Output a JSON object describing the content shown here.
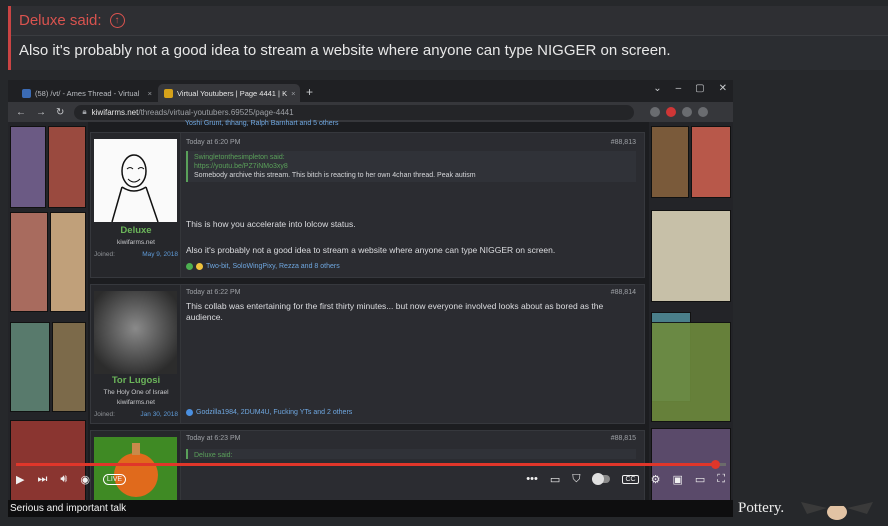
{
  "quote": {
    "author": "Deluxe said:",
    "text": "Also it's probably not a good idea to stream a website where anyone can type NIGGER on screen."
  },
  "browser": {
    "tabs": [
      {
        "label": "(58) /vt/ - Ames Thread - Virtual",
        "active": false
      },
      {
        "label": "Virtual Youtubers | Page 4441 | K",
        "active": true
      }
    ],
    "url_host": "kiwifarms.net",
    "url_path": "/threads/virtual-youtubers.69525/page-4441"
  },
  "forum": {
    "top_reactions": "Yoshi Grunt, thhang, Ralph Barnhart and 5 others",
    "posts": [
      {
        "user": "Deluxe",
        "user_title": "kiwifarms.net",
        "joined_label": "Joined:",
        "joined_date": "May 9, 2018",
        "time": "Today at 6:20 PM",
        "number": "#88,813",
        "quote_head": "Swingletonthesimpleton said:",
        "quote_link": "https://youtu.be/PZ7iNMo3xy8",
        "quote_text": "Somebody archive this stream. This bitch is reacting to her own 4chan thread. Peak autism",
        "text1": "This is how you accelerate into lolcow status.",
        "text2": "Also it's probably not a good idea to stream a website where anyone can type NIGGER on screen.",
        "reactions": "Two-bit, SoloWingPixy, Rezza and 8 others"
      },
      {
        "user": "Tor Lugosi",
        "user_title": "The Holy One of Israel",
        "user_sub": "kiwifarms.net",
        "joined_label": "Joined:",
        "joined_date": "Jan 30, 2018",
        "time": "Today at 6:22 PM",
        "number": "#88,814",
        "text1": "This collab was entertaining for the first thirty minutes... but now everyone involved looks about as bored as the audience.",
        "reactions": "Godzilla1984, 2DUM4U, Fucking YTs and 2 others"
      },
      {
        "time": "Today at 6:23 PM",
        "number": "#88,815",
        "quote_head": "Deluxe said:"
      }
    ]
  },
  "player": {
    "progress": 0.985,
    "live_label": "LIVE",
    "caption": "Serious and important talk",
    "timestamp": "3/16/2022"
  },
  "chat_text": "Pottery.",
  "colors": {
    "quote_accent": "#d9534f",
    "username_green": "#6bb55a",
    "progress_red": "#e0362a"
  }
}
